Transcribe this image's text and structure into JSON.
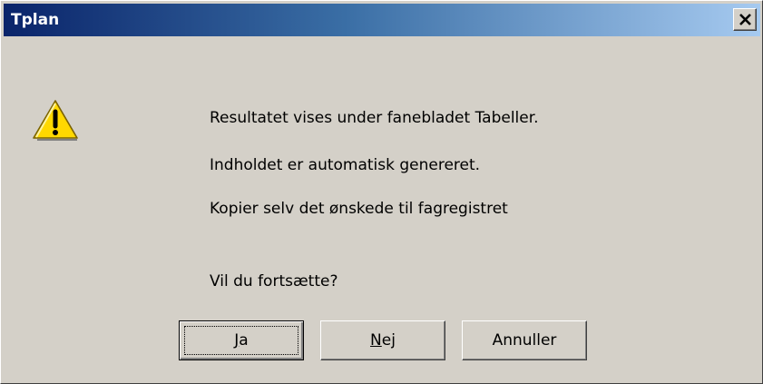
{
  "window": {
    "title": "Tplan",
    "close_label": "Close"
  },
  "icons": {
    "warning": "warning-icon",
    "close": "close-icon"
  },
  "message": {
    "line1": "Resultatet vises under fanebladet Tabeller.",
    "line2": "Indholdet er automatisk genereret.",
    "line3": "Kopier selv det ønskede til fagregistret",
    "question": "Vil du fortsætte?"
  },
  "buttons": {
    "yes": {
      "mnemonic": "J",
      "rest": "a"
    },
    "no": {
      "mnemonic": "N",
      "rest": "ej"
    },
    "cancel": {
      "label": "Annuller"
    }
  },
  "colors": {
    "face": "#d4d0c8",
    "title_start": "#0a246a",
    "title_end": "#a6caf0"
  }
}
